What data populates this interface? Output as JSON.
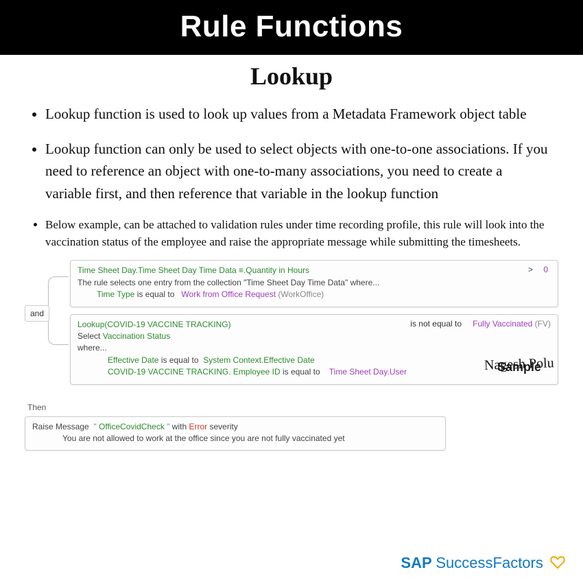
{
  "banner": "Rule Functions",
  "subtitle": "Lookup",
  "bullets": [
    "Lookup function is used to look up values from a Metadata Framework object table",
    "Lookup function can only be used to select objects with one-to-one associations. If you need to reference an object with one-to-many associations, you need to create a variable first, and then reference that variable in the lookup function",
    "Below example, can be attached to validation rules under time recording profile, this rule will look into the vaccination status of the employee and raise the appropriate message while submitting the timesheets."
  ],
  "rule": {
    "logic": "and",
    "cond1": {
      "header_path": "Time Sheet Day.Time Sheet Day Time Data ≡.Quantity in Hours",
      "operator": ">",
      "value": "0",
      "note": "The rule selects one entry from the collection \"Time Sheet Day Time Data\" where...",
      "sub_field": "Time Type",
      "sub_op": "is equal to",
      "sub_val": "Work from Office Request",
      "sub_val_code": "(WorkOffice)"
    },
    "cond2": {
      "lookup_label": "Lookup(COVID-19 VACCINE TRACKING)",
      "operator": "is not equal to",
      "value": "Fully Vaccinated",
      "value_code": "(FV)",
      "select_prefix": "Select",
      "select_field": "Vaccination Status",
      "where": "where...",
      "crit1_field": "Effective Date",
      "crit1_op": "is equal to",
      "crit1_val": "System Context.Effective Date",
      "crit2_field": "COVID-19 VACCINE TRACKING. Employee ID",
      "crit2_op": "is equal to",
      "crit2_val": "Time Sheet Day.User"
    },
    "sample": "Sample"
  },
  "then": {
    "label": "Then",
    "action": "Raise Message",
    "quote_open": "\"",
    "msg_key": "OfficeCovidCheck",
    "quote_close": "\"",
    "with": "with",
    "severity": "Error",
    "severity_suffix": "severity",
    "message_text": "You are not allowed to work at the office since you are not fully vaccinated yet"
  },
  "author": "Nagesh Polu",
  "brand": {
    "sap": "SAP",
    "product": "SuccessFactors"
  }
}
